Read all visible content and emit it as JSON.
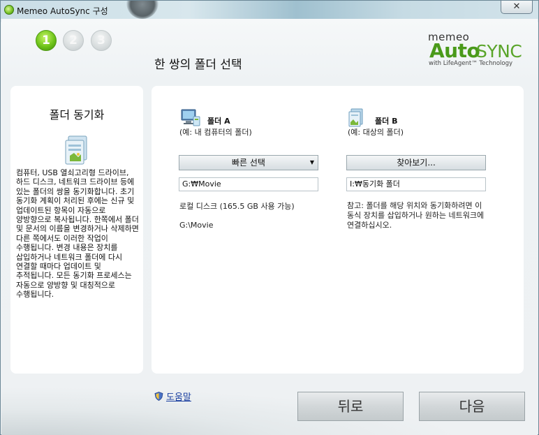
{
  "window": {
    "title": "Memeo AutoSync 구성",
    "close_label": "✕"
  },
  "steps": [
    "1",
    "2",
    "3"
  ],
  "page_title": "한 쌍의 폴더 선택",
  "logo": {
    "memeo": "memeo",
    "auto": "Auto",
    "sync": "SYNC",
    "tagline": "with LifeAgent™ Technology"
  },
  "left_panel": {
    "title": "폴더 동기화",
    "description": "컴퓨터, USB 열쇠고리형 드라이브, 하드 디스크, 네트워크 드라이브 등에 있는 폴더의 쌍을 동기화합니다. 초기 동기화 계획이 처리된 후에는 신규 및 업데이트된 항목이 자동으로 양방향으로 복사됩니다. 한쪽에서 폴더 및 문서의 이름을 변경하거나 삭제하면 다른 쪽에서도 이러한 작업이 수행됩니다. 변경 내용은 장치를 삽입하거나 네트워크 폴더에 다시 연결할 때마다 업데이트 및 추적됩니다. 모든 동기화 프로세스는 자동으로 양방향 및 대칭적으로 수행됩니다."
  },
  "folder_a": {
    "name": "폴더 A",
    "subtitle": "(예: 내 컴퓨터의 폴더)",
    "quick_select_label": "빠른 선택",
    "path_value": "G:₩Movie",
    "disk_info": "로컬 디스크 (165.5 GB 사용 가능)",
    "disk_path": "G:\\Movie"
  },
  "folder_b": {
    "name": "폴더 B",
    "subtitle": "(예: 대상의 폴더)",
    "browse_label": "찾아보기...",
    "path_value": "I:₩동기화 폴더",
    "note": "참고: 폴더를 해당 위치와 동기화하려면 이동식 장치를 삽입하거나 원하는 네트워크에 연결하십시오."
  },
  "footer": {
    "help_label": "도움말",
    "back_label": "뒤로",
    "next_label": "다음"
  },
  "colors": {
    "accent_green": "#6fc41a",
    "link_blue": "#1a3fa0"
  }
}
